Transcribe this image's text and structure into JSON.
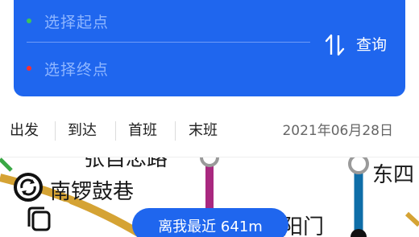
{
  "search": {
    "start_placeholder": "选择起点",
    "end_placeholder": "选择终点",
    "query_label": "查询",
    "start_dot_color": "#3ec45a",
    "end_dot_color": "#ff2d2d",
    "panel_color": "#1f66ee"
  },
  "filters": {
    "tabs": [
      {
        "label": "出发"
      },
      {
        "label": "到达"
      },
      {
        "label": "首班"
      },
      {
        "label": "末班"
      }
    ],
    "date": "2021年06月28日"
  },
  "map": {
    "stations": {
      "zhangzizhong_partial": "张自忠路",
      "nanluoguxiang": "南锣鼓巷",
      "dongsi_partial": "东四",
      "chaoyangmen_partial": "朝阳门"
    },
    "line_colors": {
      "line6": "#d5a334",
      "line5": "#a9287f",
      "blue_line": "#0f6ea8",
      "transfer_ring": "#9a9a9a"
    },
    "nearest_button": "离我最近 641m"
  }
}
